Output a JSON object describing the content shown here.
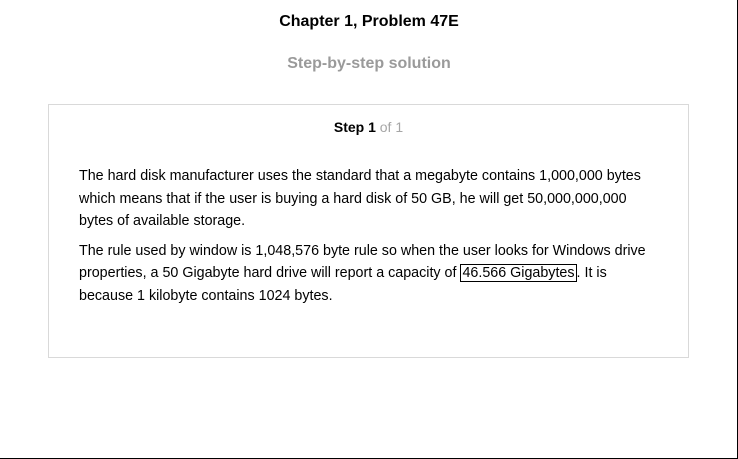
{
  "header": {
    "title": "Chapter 1, Problem 47E",
    "subtitle": "Step-by-step solution"
  },
  "step": {
    "label": "Step 1",
    "of_text": "of 1",
    "paragraph1": "The hard disk manufacturer uses the standard that a megabyte contains 1,000,000 bytes which means that if the user is buying a hard disk of 50 GB, he will get 50,000,000,000 bytes of available storage.",
    "paragraph2_before": "The rule used by window is 1,048,576 byte rule so when the user looks for Windows drive properties, a 50 Gigabyte hard drive will report a capacity of ",
    "paragraph2_highlight": "46.566 Gigabytes",
    "paragraph2_after": ". It is because 1 kilobyte contains 1024 bytes."
  }
}
